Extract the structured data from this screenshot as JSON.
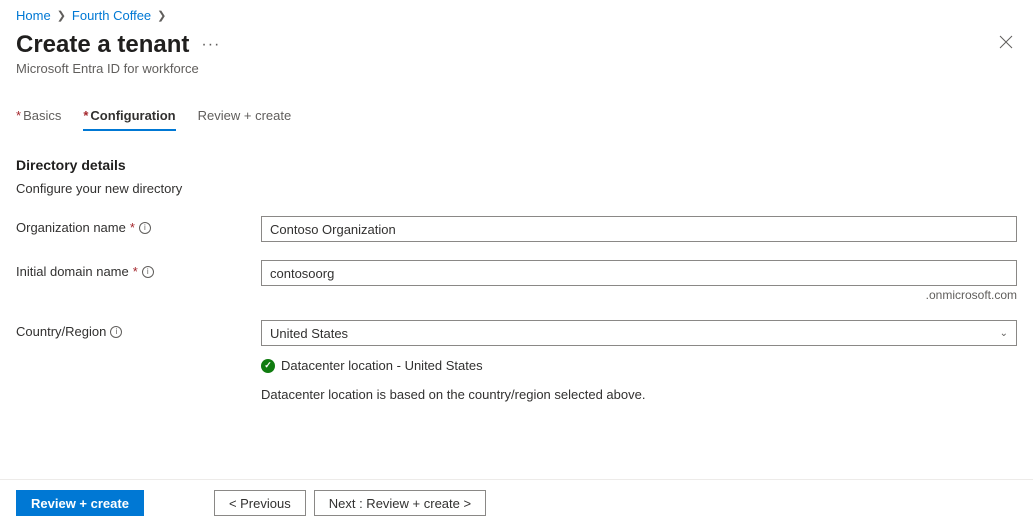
{
  "breadcrumb": {
    "home": "Home",
    "parent": "Fourth Coffee"
  },
  "header": {
    "title": "Create a tenant",
    "subtitle": "Microsoft Entra ID for workforce"
  },
  "tabs": {
    "basics": "Basics",
    "configuration": "Configuration",
    "review": "Review + create"
  },
  "section": {
    "title": "Directory details",
    "description": "Configure your new directory"
  },
  "fields": {
    "org_label": "Organization name",
    "org_value": "Contoso Organization",
    "domain_label": "Initial domain name",
    "domain_value": "contosoorg",
    "domain_suffix": ".onmicrosoft.com",
    "region_label": "Country/Region",
    "region_value": "United States"
  },
  "status": {
    "datacenter": "Datacenter location - United States",
    "note": "Datacenter location is based on the country/region selected above."
  },
  "footer": {
    "review": "Review + create",
    "previous": "< Previous",
    "next": "Next : Review + create >"
  }
}
